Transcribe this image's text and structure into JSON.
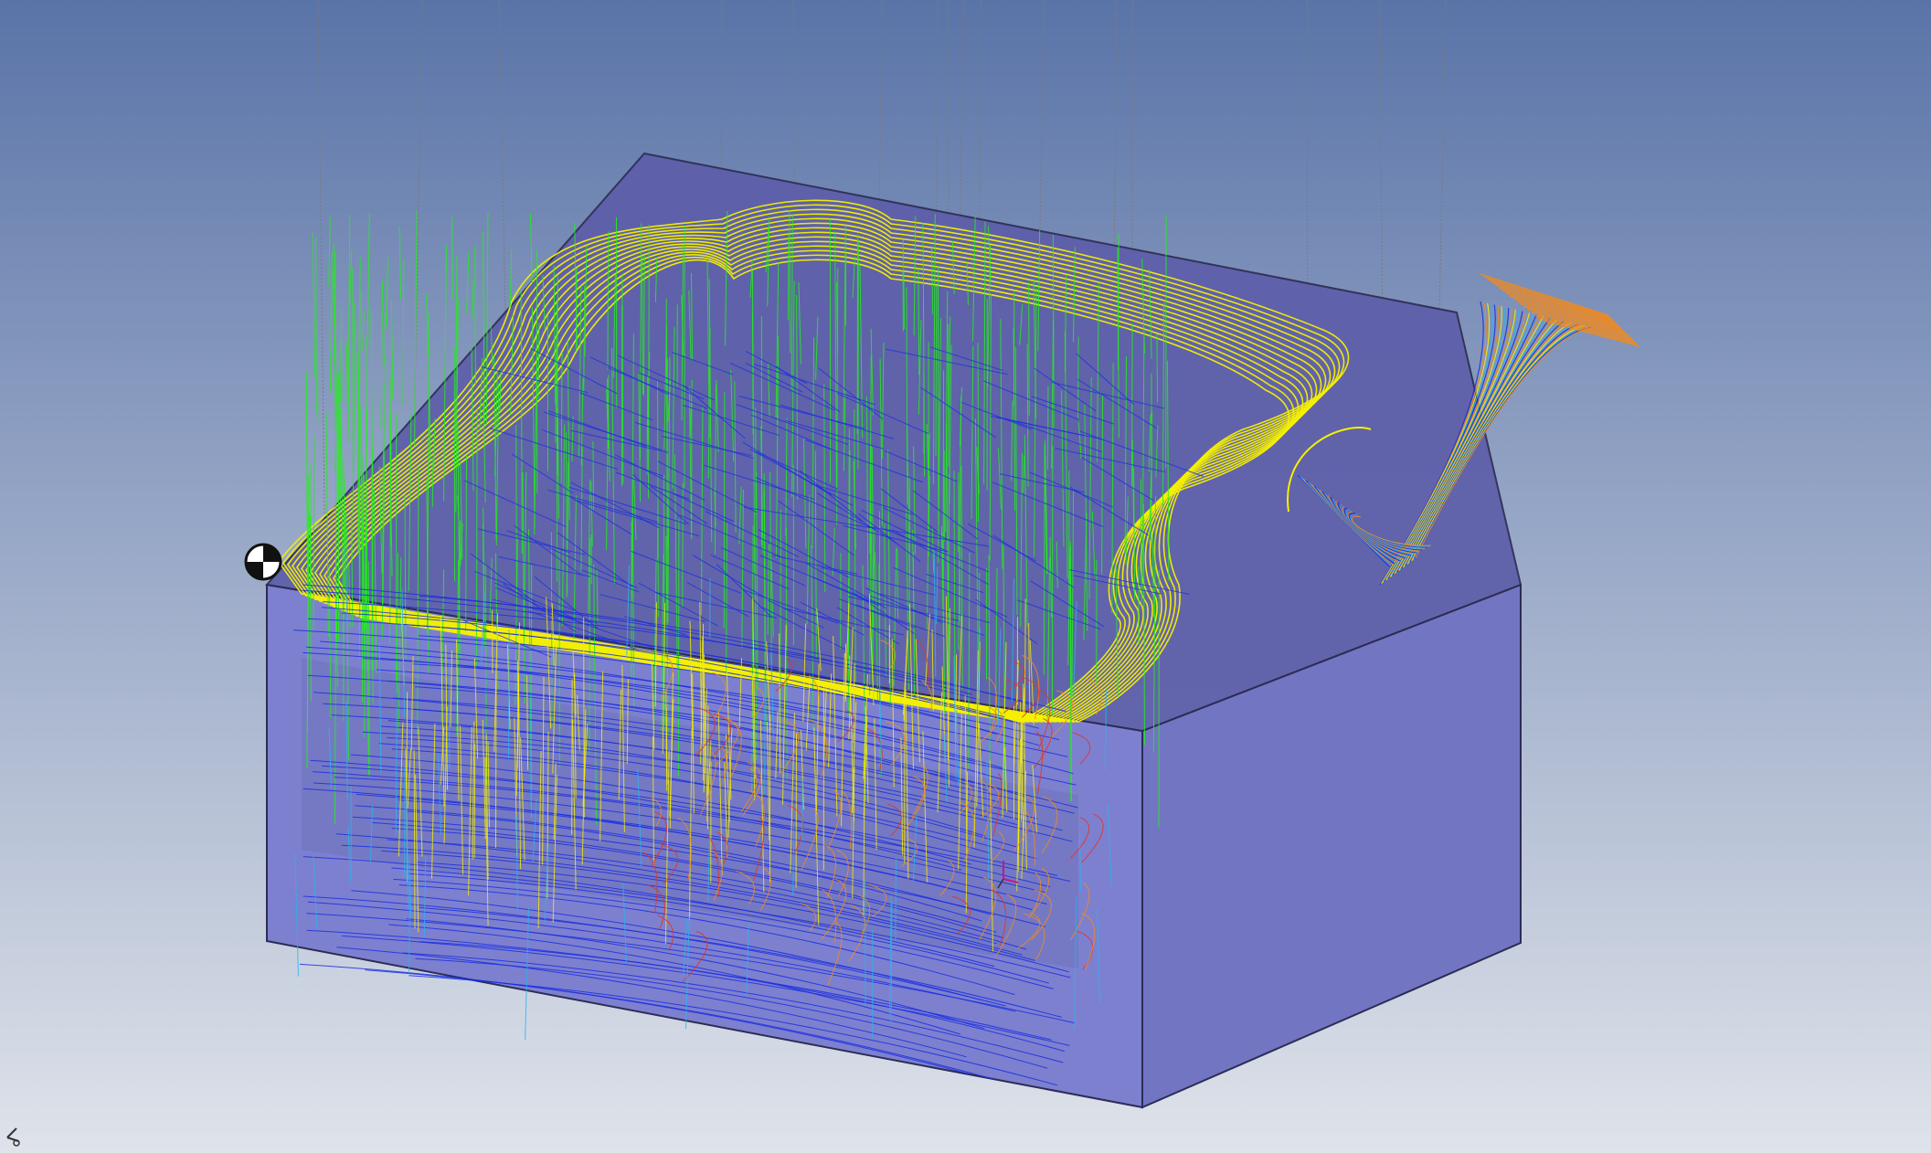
{
  "viewport": {
    "background_top": "#5a74a8",
    "background_bottom": "#dfe3ea"
  },
  "stock_block": {
    "top_face_color": "#5d5ea9",
    "front_face_color": "#7d80cf",
    "right_face_color": "#7275c2",
    "edge_color": "#2c2c55"
  },
  "toolpath_colors": {
    "rapid": "#7a7a7a",
    "cut_yellow": "#f5f000",
    "cut_green": "#22ee1a",
    "cut_blue": "#1a2ee0",
    "cut_orange": "#f08a20",
    "cut_cyan": "#29b3f0",
    "cut_red": "#e8321c"
  },
  "icons": {
    "origin_marker": "datum-origin-icon",
    "triad": "coordinate-triad-icon"
  }
}
